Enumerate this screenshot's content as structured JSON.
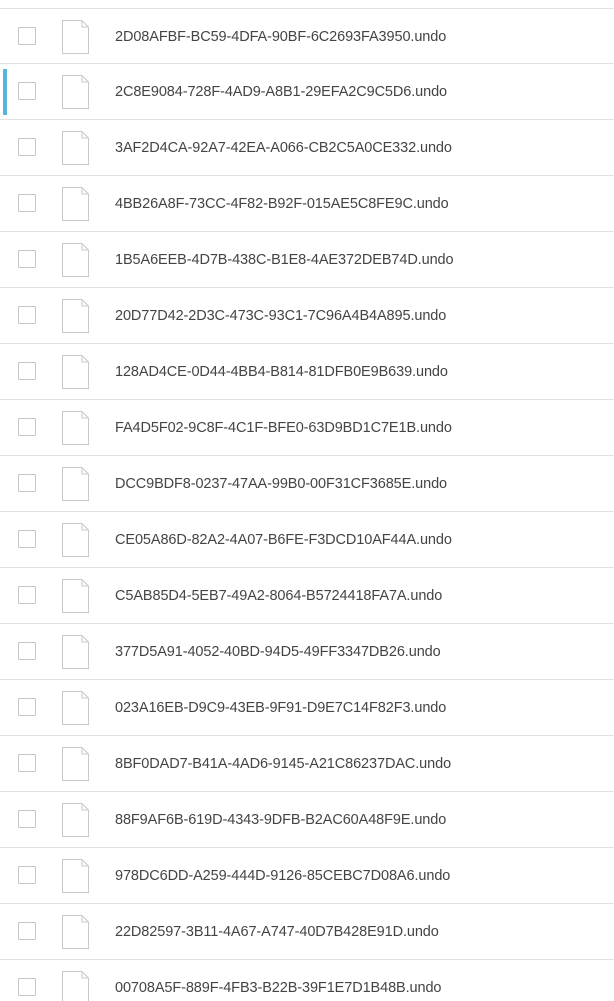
{
  "file_list": {
    "items": [
      {
        "name": "2D08AFBF-BC59-4DFA-90BF-6C2693FA3950.undo",
        "selected": false,
        "active": false
      },
      {
        "name": "2C8E9084-728F-4AD9-A8B1-29EFA2C9C5D6.undo",
        "selected": false,
        "active": true
      },
      {
        "name": "3AF2D4CA-92A7-42EA-A066-CB2C5A0CE332.undo",
        "selected": false,
        "active": false
      },
      {
        "name": "4BB26A8F-73CC-4F82-B92F-015AE5C8FE9C.undo",
        "selected": false,
        "active": false
      },
      {
        "name": "1B5A6EEB-4D7B-438C-B1E8-4AE372DEB74D.undo",
        "selected": false,
        "active": false
      },
      {
        "name": "20D77D42-2D3C-473C-93C1-7C96A4B4A895.undo",
        "selected": false,
        "active": false
      },
      {
        "name": "128AD4CE-0D44-4BB4-B814-81DFB0E9B639.undo",
        "selected": false,
        "active": false
      },
      {
        "name": "FA4D5F02-9C8F-4C1F-BFE0-63D9BD1C7E1B.undo",
        "selected": false,
        "active": false
      },
      {
        "name": "DCC9BDF8-0237-47AA-99B0-00F31CF3685E.undo",
        "selected": false,
        "active": false
      },
      {
        "name": "CE05A86D-82A2-4A07-B6FE-F3DCD10AF44A.undo",
        "selected": false,
        "active": false
      },
      {
        "name": "C5AB85D4-5EB7-49A2-8064-B5724418FA7A.undo",
        "selected": false,
        "active": false
      },
      {
        "name": "377D5A91-4052-40BD-94D5-49FF3347DB26.undo",
        "selected": false,
        "active": false
      },
      {
        "name": "023A16EB-D9C9-43EB-9F91-D9E7C14F82F3.undo",
        "selected": false,
        "active": false
      },
      {
        "name": "8BF0DAD7-B41A-4AD6-9145-A21C86237DAC.undo",
        "selected": false,
        "active": false
      },
      {
        "name": "88F9AF6B-619D-4343-9DFB-B2AC60A48F9E.undo",
        "selected": false,
        "active": false
      },
      {
        "name": "978DC6DD-A259-444D-9126-85CEBC7D08A6.undo",
        "selected": false,
        "active": false
      },
      {
        "name": "22D82597-3B11-4A67-A747-40D7B428E91D.undo",
        "selected": false,
        "active": false
      },
      {
        "name": "00708A5F-889F-4FB3-B22B-39F1E7D1B48B.undo",
        "selected": false,
        "active": false
      }
    ],
    "icon": "document-icon"
  },
  "colors": {
    "accent": "#54b6dc",
    "divider": "#e2e2e2",
    "text": "#444444",
    "checkbox_border": "#c6c6c6"
  }
}
